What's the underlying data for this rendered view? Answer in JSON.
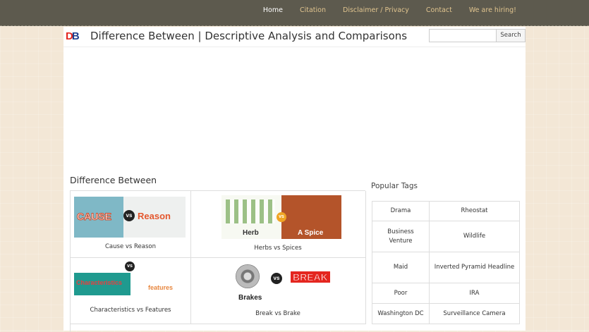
{
  "topnav": [
    "Home",
    "Citation",
    "Disclaimer / Privacy",
    "Contact",
    "We are hiring!"
  ],
  "logo": {
    "d": "D",
    "b": "B"
  },
  "site_title": "Difference Between | Descriptive Analysis and Comparisons",
  "search": {
    "button_label": "Search",
    "placeholder": ""
  },
  "section_title": "Difference Between",
  "articles": [
    {
      "caption": "Cause vs Reason",
      "left": "CAUSE",
      "vs": "vs",
      "right": "Reason"
    },
    {
      "caption": "Herbs vs Spices",
      "left": "Herb",
      "vs": "vs",
      "right": "A Spice"
    },
    {
      "caption": "Characteristics vs Features",
      "left": "Characteristics",
      "vs": "vs",
      "right": "features"
    },
    {
      "caption": "Break vs Brake",
      "left": "Brakes",
      "vs": "vs",
      "right": "BREAK"
    }
  ],
  "tags_title": "Popular Tags",
  "tags": [
    [
      "Drama",
      "Rheostat"
    ],
    [
      "Business Venture",
      "Wildlife"
    ],
    [
      "Maid",
      "Inverted Pyramid Headline"
    ],
    [
      "Poor",
      "IRA"
    ],
    [
      "Washington DC",
      "Surveillance Camera"
    ]
  ],
  "colors": {
    "topbar": "#5d5a4e",
    "nav_link": "#e0c48f",
    "nav_active": "#ffffff",
    "logo_red": "#e4261f",
    "logo_blue": "#1d3f8f"
  }
}
